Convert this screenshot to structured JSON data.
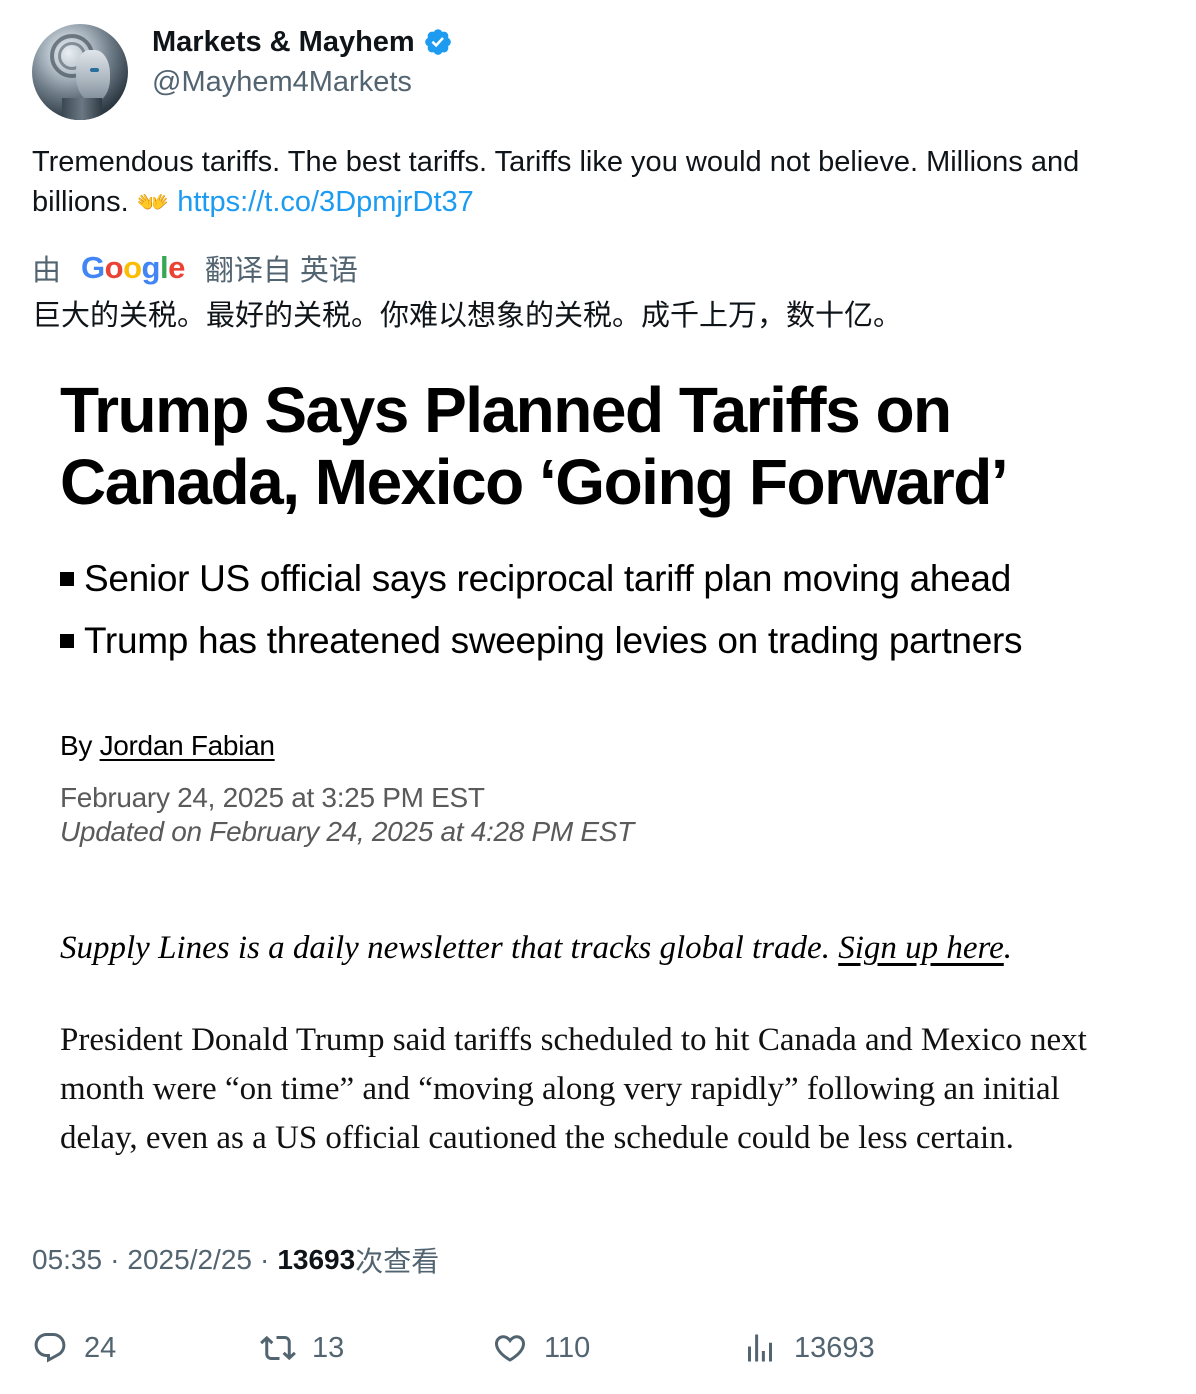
{
  "author": {
    "display_name": "Markets & Mayhem",
    "handle": "@Mayhem4Markets",
    "verified": true
  },
  "tweet": {
    "text": "Tremendous tariffs. The best tariffs. Tariffs like you would not believe. Millions and billions.",
    "emoji": "👐",
    "link": "https://t.co/3DpmjrDt37"
  },
  "translation": {
    "prefix": "由",
    "provider": "Google",
    "suffix": "翻译自 英语",
    "text": "巨大的关税。最好的关税。你难以想象的关税。成千上万，数十亿。"
  },
  "article": {
    "headline": "Trump Says Planned Tariffs on Canada, Mexico ‘Going Forward’",
    "bullets": [
      "Senior US official says reciprocal tariff plan moving ahead",
      "Trump has threatened sweeping levies on trading partners"
    ],
    "byline_prefix": "By",
    "author": "Jordan Fabian",
    "date": "February 24, 2025 at 3:25 PM EST",
    "updated": "Updated on February 24, 2025 at 4:28 PM EST",
    "newsletter_text": "Supply Lines is a daily newsletter that tracks global trade.",
    "newsletter_link": "Sign up here",
    "newsletter_end": ".",
    "body": "President Donald Trump said tariffs scheduled to hit Canada and Mexico next month were “on time” and “moving along very rapidly” following an initial delay, even as a US official cautioned the schedule could be less certain."
  },
  "meta": {
    "time": "05:35",
    "separator": "·",
    "date": "2025/2/25",
    "views": "13693",
    "views_label": "次查看"
  },
  "actions": {
    "replies": "24",
    "retweets": "13",
    "likes": "110",
    "views": "13693"
  },
  "colors": {
    "link": "#1d9bf0",
    "secondary_text": "#536471",
    "verified": "#1d9bf0"
  }
}
